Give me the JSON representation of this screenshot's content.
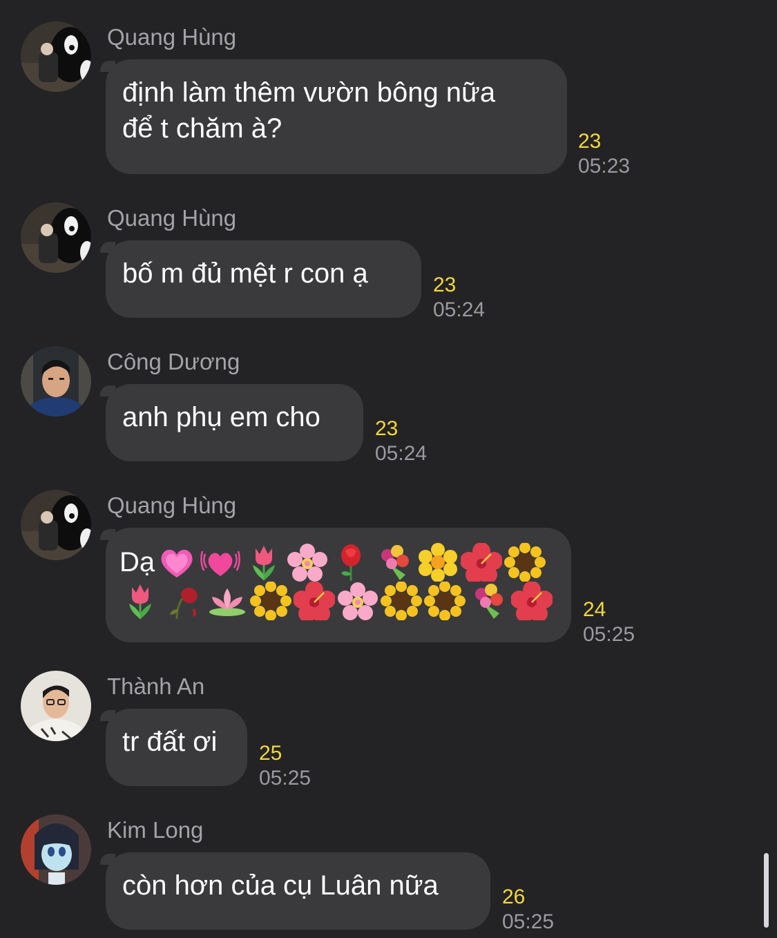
{
  "messages": [
    {
      "sender": "Quang Hùng",
      "text": "định làm thêm vườn bông nữa\nđể t chăm à?",
      "reads": "23",
      "time": "05:23",
      "avatar": "photo-black-cartoon"
    },
    {
      "sender": "Quang Hùng",
      "text": "bố m đủ mệt r con ạ",
      "reads": "23",
      "time": "05:24",
      "avatar": "photo-black-cartoon"
    },
    {
      "sender": "Công Dương",
      "text": "anh phụ em cho",
      "reads": "23",
      "time": "05:24",
      "avatar": "photo-young-man"
    },
    {
      "sender": "Quang Hùng",
      "text": "Dạ",
      "reads": "24",
      "time": "05:25",
      "avatar": "photo-black-cartoon",
      "emojis_row1": [
        "heart-pink-icon",
        "heart-growing-icon",
        "tulip-icon",
        "cherry-blossom-icon",
        "rose-icon",
        "bouquet-icon",
        "blossom-icon",
        "hibiscus-icon",
        "sunflower-icon"
      ],
      "emojis_row2": [
        "tulip-icon",
        "wilted-rose-icon",
        "lotus-icon",
        "sunflower-icon",
        "hibiscus-icon",
        "cherry-blossom-icon",
        "sunflower-icon",
        "sunflower-icon",
        "bouquet-icon",
        "hibiscus-icon"
      ]
    },
    {
      "sender": "Thành An",
      "text": "tr đất ơi",
      "reads": "25",
      "time": "05:25",
      "avatar": "photo-smiling-man"
    },
    {
      "sender": "Kim Long",
      "text": "còn hơn của cụ Luân nữa",
      "reads": "26",
      "time": "05:25",
      "avatar": "photo-anime-figure"
    }
  ],
  "colors": {
    "background": "#232325",
    "bubble": "#3a3a3d",
    "read_count": "#f4d93a",
    "timestamp": "#9a9aa0",
    "sender": "#a3a3a8"
  }
}
